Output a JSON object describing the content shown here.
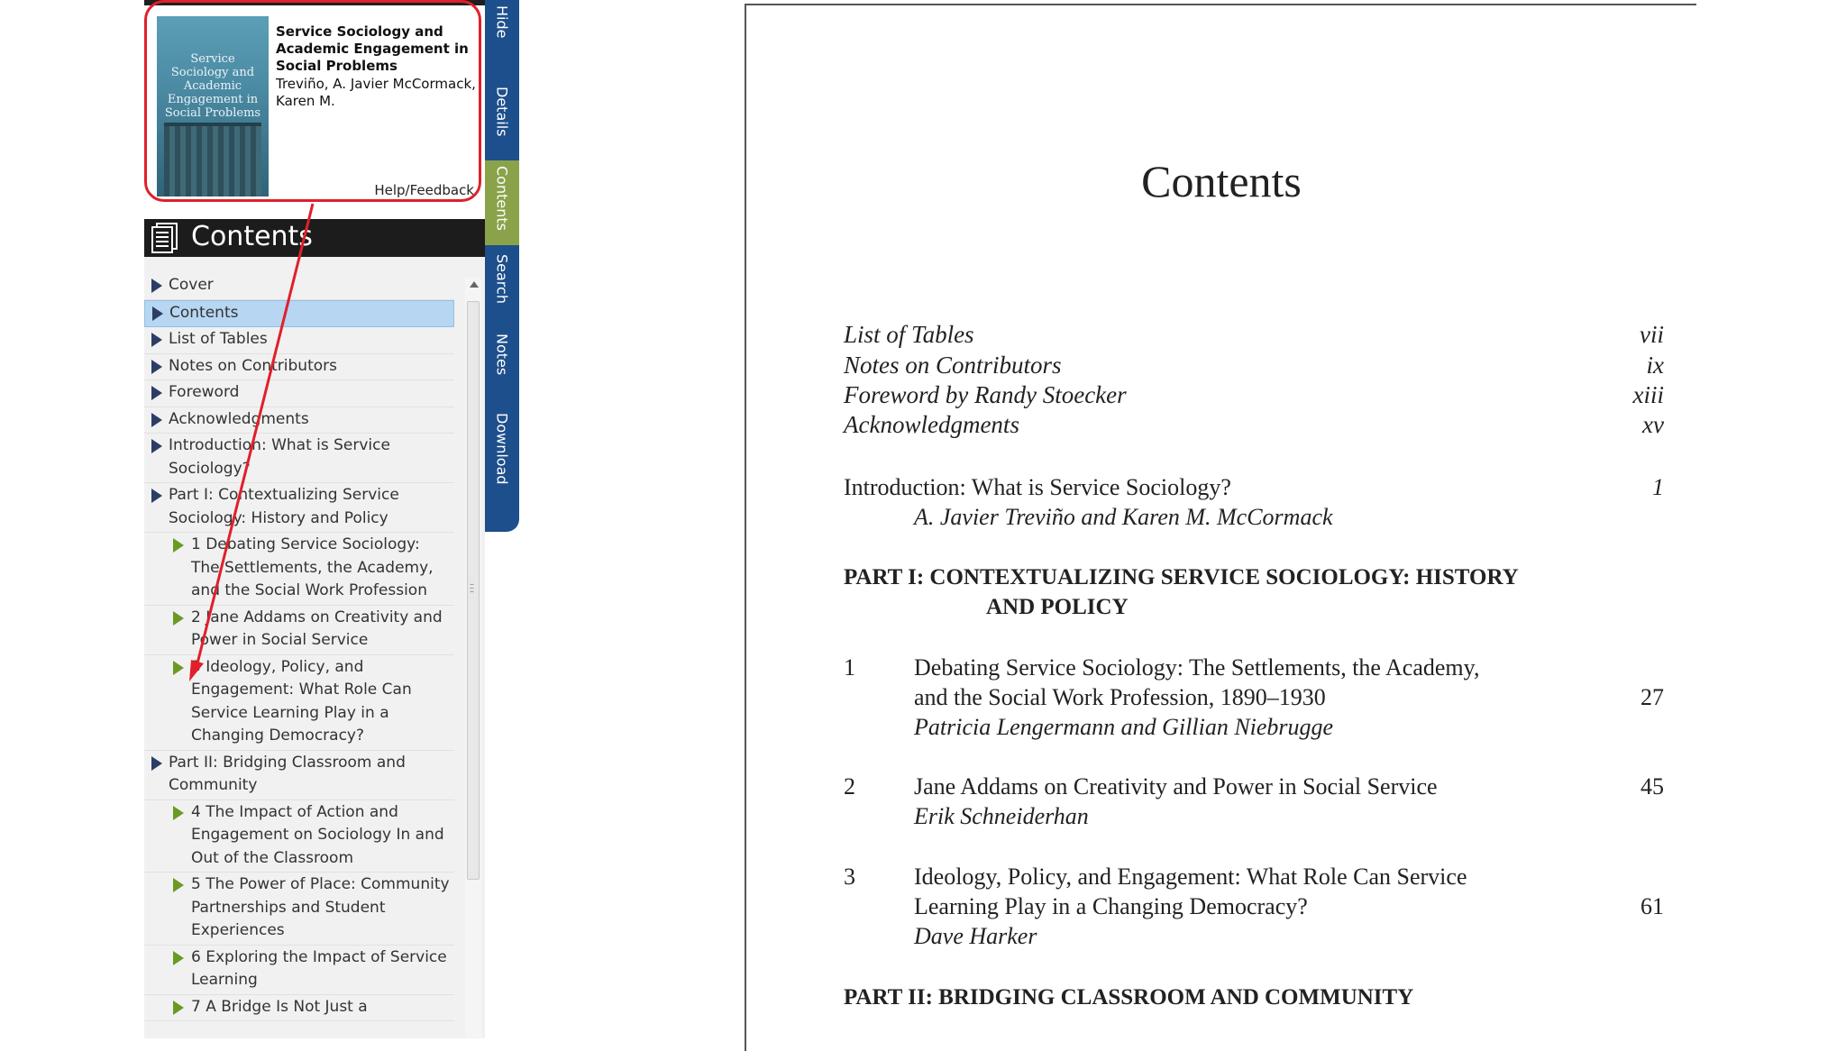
{
  "book": {
    "title": "Service Sociology and Academic Engagement in Social Problems",
    "authors": "Treviño, A. Javier McCormack, Karen M.",
    "cover_title": "Service Sociology and Academic Engagement in Social Problems",
    "help_label": "Help/Feedback"
  },
  "sidebar": {
    "header": "Contents",
    "items": [
      {
        "label": "Cover",
        "level": 0
      },
      {
        "label": "Contents",
        "level": 0,
        "selected": true
      },
      {
        "label": "List of Tables",
        "level": 0
      },
      {
        "label": "Notes on Contributors",
        "level": 0
      },
      {
        "label": "Foreword",
        "level": 0
      },
      {
        "label": "Acknowledgments",
        "level": 0
      },
      {
        "label": "Introduction: What is Service Sociology?",
        "level": 0
      },
      {
        "label": "Part I: Contextualizing Service Sociology: History and Policy",
        "level": 0
      },
      {
        "label": "1 Debating Service Sociology: The Settlements, the Academy, and the Social Work Profession",
        "level": 1
      },
      {
        "label": "2 Jane Addams on Creativity and Power in Social Service",
        "level": 1
      },
      {
        "label": "3 Ideology, Policy, and Engagement: What Role Can Service Learning Play in a Changing Democracy?",
        "level": 1
      },
      {
        "label": "Part II: Bridging Classroom and Community",
        "level": 0
      },
      {
        "label": "4 The Impact of Action and Engagement on Sociology In and Out of the Classroom",
        "level": 1
      },
      {
        "label": "5 The Power of Place: Community Partnerships and Student Experiences",
        "level": 1
      },
      {
        "label": "6 Exploring the Impact of Service Learning",
        "level": 1
      },
      {
        "label": "7 A Bridge Is Not Just a",
        "level": 1
      }
    ]
  },
  "tabs": [
    {
      "label": "Hide"
    },
    {
      "label": "Details"
    },
    {
      "label": "Contents",
      "active": true
    },
    {
      "label": "Search"
    },
    {
      "label": "Notes"
    },
    {
      "label": "Download"
    }
  ],
  "document": {
    "title": "Contents",
    "front_matter": [
      {
        "title": "List of Tables",
        "page": "vii"
      },
      {
        "title": "Notes on Contributors",
        "page": "ix"
      },
      {
        "title": "Foreword by Randy Stoecker",
        "page": "xiii"
      },
      {
        "title": "Acknowledgments",
        "page": "xv"
      }
    ],
    "intro": {
      "title": "Introduction: What is Service Sociology?",
      "page": "1",
      "authors": "A. Javier Treviño and Karen M. McCormack"
    },
    "part1": {
      "line1": "PART I: CONTEXTUALIZING SERVICE SOCIOLOGY: HISTORY",
      "line2": "AND POLICY"
    },
    "chapters": [
      {
        "num": "1",
        "line1": "Debating Service Sociology: The Settlements, the Academy,",
        "line2": "and the Social Work Profession, 1890–1930",
        "authors": "Patricia Lengermann and Gillian Niebrugge",
        "page": "27"
      },
      {
        "num": "2",
        "line1": "Jane Addams on Creativity and Power in Social Service",
        "line2": "",
        "authors": "Erik Schneiderhan",
        "page": "45"
      },
      {
        "num": "3",
        "line1": "Ideology, Policy, and Engagement: What Role Can Service",
        "line2": "Learning Play in a Changing Democracy?",
        "authors": "Dave Harker",
        "page": "61"
      }
    ],
    "part2": "PART II: BRIDGING CLASSROOM AND COMMUNITY"
  },
  "colors": {
    "annotation": "#e0202a",
    "tab_bar": "#1d4f8c",
    "tab_active": "#8aa34a",
    "selected_item": "#b7d6f2"
  }
}
